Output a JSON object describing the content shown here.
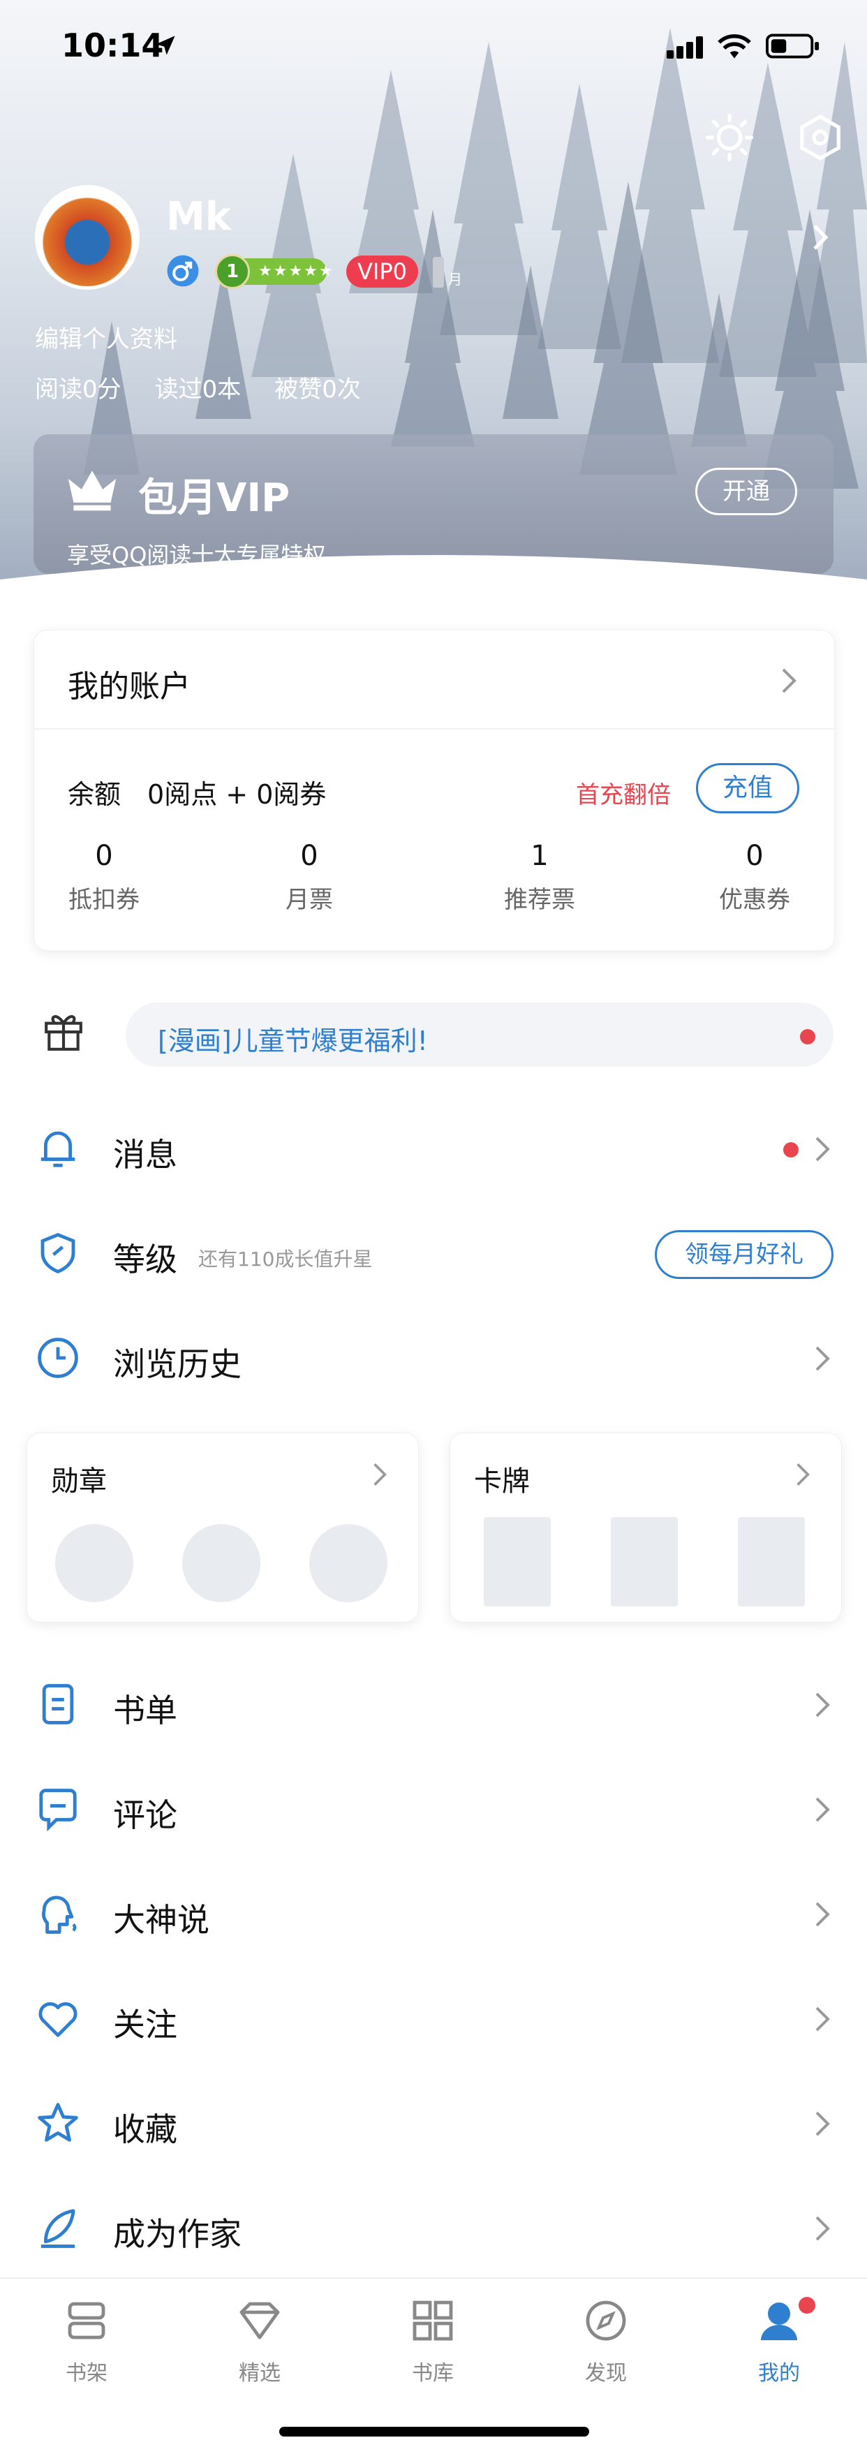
{
  "status_bar": {
    "time": "10:14"
  },
  "profile": {
    "username": "Mk",
    "level": "1",
    "level_stars": "★★★★★",
    "vip_badge": "VIP0",
    "month_badge": "月",
    "edit_profile": "编辑个人资料",
    "stats": [
      "阅读0分",
      "读过0本",
      "被赞0次"
    ]
  },
  "vip_card": {
    "title": "包月VIP",
    "subtitle": "享受QQ阅读十大专属特权",
    "open_label": "开通"
  },
  "account": {
    "title": "我的账户",
    "balance_label": "余额",
    "balance_value": "0阅点 + 0阅券",
    "double_text": "首充翻倍",
    "recharge_label": "充值",
    "metrics": [
      {
        "value": "0",
        "label": "抵扣券"
      },
      {
        "value": "0",
        "label": "月票"
      },
      {
        "value": "1",
        "label": "推荐票"
      },
      {
        "value": "0",
        "label": "优惠券"
      }
    ]
  },
  "promo": {
    "text": "[漫画]儿童节爆更福利!"
  },
  "menu": {
    "messages": "消息",
    "level": "等级",
    "level_hint": "还有110成长值升星",
    "level_button": "领每月好礼",
    "history": "浏览历史",
    "booklist": "书单",
    "comments": "评论",
    "master_talk": "大神说",
    "follow": "关注",
    "favorites": "收藏",
    "become_writer": "成为作家"
  },
  "cards": {
    "medals": "勋章",
    "card_deck": "卡牌"
  },
  "tabbar": {
    "items": [
      {
        "label": "书架",
        "icon": "bookshelf-icon"
      },
      {
        "label": "精选",
        "icon": "diamond-icon"
      },
      {
        "label": "书库",
        "icon": "grid-icon"
      },
      {
        "label": "发现",
        "icon": "compass-icon"
      },
      {
        "label": "我的",
        "icon": "person-icon"
      }
    ],
    "active": "我的"
  },
  "colors": {
    "accent": "#2f7fd1",
    "alert": "#e8454e",
    "vip": "#ee3d4e"
  }
}
